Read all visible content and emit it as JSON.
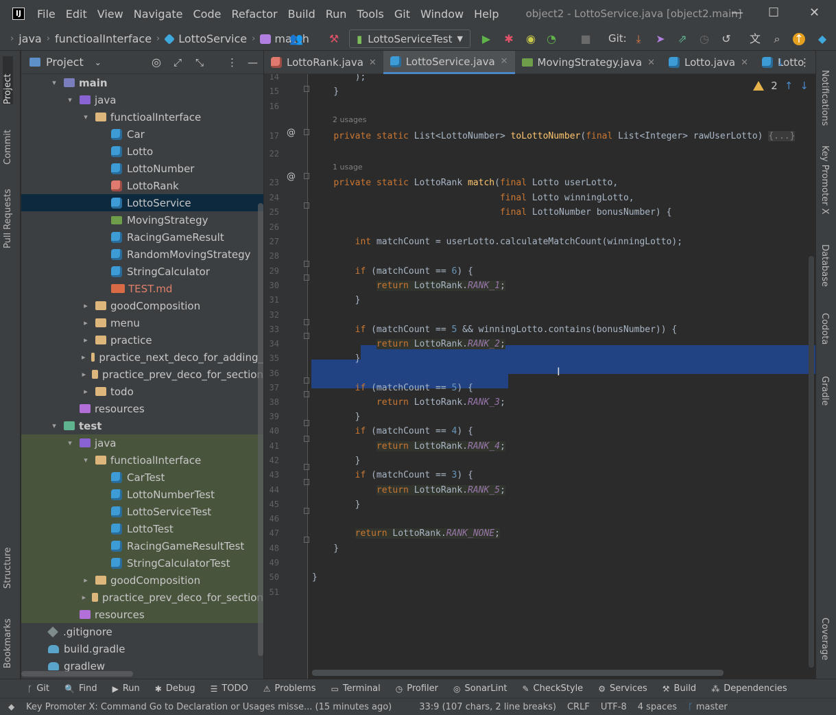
{
  "window": {
    "title": "object2 - LottoService.java [object2.main]",
    "menu": [
      "File",
      "Edit",
      "View",
      "Navigate",
      "Code",
      "Refactor",
      "Build",
      "Run",
      "Tools",
      "Git",
      "Window",
      "Help"
    ],
    "controls": [
      "—",
      "☐",
      "✕"
    ]
  },
  "navbar": {
    "breadcrumbs": [
      "java",
      "functioalInterface",
      "LottoService",
      "match"
    ],
    "run_config": "LottoServiceTest",
    "git_label": "Git:"
  },
  "left_stripe": {
    "tabs": [
      "Project",
      "Commit",
      "Pull Requests",
      "Structure",
      "Bookmarks"
    ]
  },
  "right_stripe": {
    "tabs": [
      "Notifications",
      "Key Promoter X",
      "Database",
      "Codota",
      "Gradle",
      "Coverage"
    ]
  },
  "project_panel": {
    "title": "Project",
    "tree": [
      {
        "label": "main",
        "kind": "folder-main",
        "arrow": "▾",
        "bold": true
      },
      {
        "label": "java",
        "kind": "folder-src",
        "arrow": "▾"
      },
      {
        "label": "functioalInterface",
        "kind": "folder",
        "arrow": "▾"
      },
      {
        "label": "Car",
        "kind": "class"
      },
      {
        "label": "Lotto",
        "kind": "class"
      },
      {
        "label": "LottoNumber",
        "kind": "class"
      },
      {
        "label": "LottoRank",
        "kind": "enum"
      },
      {
        "label": "LottoService",
        "kind": "class",
        "selected": true
      },
      {
        "label": "MovingStrategy",
        "kind": "iface"
      },
      {
        "label": "RacingGameResult",
        "kind": "class"
      },
      {
        "label": "RandomMovingStrategy",
        "kind": "class"
      },
      {
        "label": "StringCalculator",
        "kind": "class"
      },
      {
        "label": "TEST.md",
        "kind": "md",
        "color": "#e0806a"
      },
      {
        "label": "goodComposition",
        "kind": "folder",
        "arrow": "▸"
      },
      {
        "label": "menu",
        "kind": "folder",
        "arrow": "▸"
      },
      {
        "label": "practice",
        "kind": "folder",
        "arrow": "▸"
      },
      {
        "label": "practice_next_deco_for_adding_",
        "kind": "folder",
        "arrow": "▸"
      },
      {
        "label": "practice_prev_deco_for_section",
        "kind": "folder",
        "arrow": "▸"
      },
      {
        "label": "todo",
        "kind": "folder",
        "arrow": "▸"
      },
      {
        "label": "resources",
        "kind": "folder-res"
      },
      {
        "label": "test",
        "kind": "folder-test",
        "arrow": "▾",
        "bold": true
      },
      {
        "label": "java",
        "kind": "folder-src",
        "arrow": "▾",
        "test": true
      },
      {
        "label": "functioalInterface",
        "kind": "folder",
        "arrow": "▾",
        "test": true
      },
      {
        "label": "CarTest",
        "kind": "class",
        "test": true
      },
      {
        "label": "LottoNumberTest",
        "kind": "class",
        "test": true
      },
      {
        "label": "LottoServiceTest",
        "kind": "class",
        "test": true
      },
      {
        "label": "LottoTest",
        "kind": "class",
        "test": true
      },
      {
        "label": "RacingGameResultTest",
        "kind": "class",
        "test": true
      },
      {
        "label": "StringCalculatorTest",
        "kind": "class",
        "test": true
      },
      {
        "label": "goodComposition",
        "kind": "folder",
        "arrow": "▸",
        "test": true
      },
      {
        "label": "practice_prev_deco_for_section",
        "kind": "folder",
        "arrow": "▸",
        "test": true
      },
      {
        "label": "resources",
        "kind": "folder-res",
        "test": true
      },
      {
        "label": ".gitignore",
        "kind": "file"
      },
      {
        "label": "build.gradle",
        "kind": "gradle"
      },
      {
        "label": "gradlew",
        "kind": "gradle"
      }
    ]
  },
  "editor_tabs": [
    {
      "label": "LottoRank.java",
      "kind": "enum"
    },
    {
      "label": "LottoService.java",
      "kind": "class",
      "active": true
    },
    {
      "label": "MovingStrategy.java",
      "kind": "iface"
    },
    {
      "label": "Lotto.java",
      "kind": "class"
    },
    {
      "label": "Lotto",
      "kind": "class"
    }
  ],
  "inspection": {
    "warnings": "2"
  },
  "code_lines": [
    {
      "n": "14",
      "html": "        );"
    },
    {
      "n": "15",
      "html": "    }"
    },
    {
      "n": "16",
      "html": ""
    },
    {
      "hint": "2 usages"
    },
    {
      "n": "17",
      "html": "    <span class='kw'>private static</span> List&lt;LottoNumber&gt; <span class='fn'>toLottoNumber</span>(<span class='kw'>final</span> List&lt;Integer&gt; rawUserLotto) <span style='color:#808080;background:#3b3b3b'>{...}</span>"
    },
    {
      "n": "22",
      "html": ""
    },
    {
      "hint": "1 usage"
    },
    {
      "n": "23",
      "html": "    <span class='kw'>private static</span> LottoRank <span class='fn'>match</span>(<span class='kw'>final</span> Lotto userLotto,"
    },
    {
      "n": "24",
      "html": "                                   <span class='kw'>final</span> Lotto winningLotto,"
    },
    {
      "n": "25",
      "html": "                                   <span class='kw'>final</span> LottoNumber bonusNumber) {"
    },
    {
      "n": "26",
      "html": ""
    },
    {
      "n": "27",
      "html": "        <span class='kw'>int</span> matchCount = userLotto.calculateMatchCount(winningLotto);"
    },
    {
      "n": "28",
      "html": ""
    },
    {
      "n": "29",
      "html": "        <span class='kw'>if</span> (matchCount <span style='color:#a9b7c6'>==</span> <span class='num'>6</span>) {"
    },
    {
      "n": "30",
      "html": "            <span class='ret-hl'><span class='kw'>return</span> LottoRank.<span class='const'>RANK_1</span>;</span>"
    },
    {
      "n": "31",
      "html": "        }"
    },
    {
      "n": "32",
      "html": ""
    },
    {
      "n": "33",
      "html": "        <span class='kw'>if</span> (matchCount == <span class='num'>5</span> &amp;&amp; winningLotto.contains(bonusNumber)) {"
    },
    {
      "n": "34",
      "html": "            <span class='ret-hl'><span class='kw'>return</span> LottoRank.<span class='const'>RANK_2</span>;</span>"
    },
    {
      "n": "35",
      "html": "        }"
    },
    {
      "n": "36",
      "html": ""
    },
    {
      "n": "37",
      "html": "        <span class='kw'>if</span> (matchCount == <span class='num'>5</span>) {"
    },
    {
      "n": "38",
      "html": "            <span class='kw'>return</span> LottoRank.<span class='const'>RANK_3</span>;"
    },
    {
      "n": "39",
      "html": "        }"
    },
    {
      "n": "40",
      "html": "        <span class='kw'>if</span> (matchCount == <span class='num'>4</span>) {"
    },
    {
      "n": "41",
      "html": "            <span class='ret-hl'><span class='kw'>return</span> LottoRank.<span class='const'>RANK_4</span>;</span>"
    },
    {
      "n": "42",
      "html": "        }"
    },
    {
      "n": "43",
      "html": "        <span class='kw'>if</span> (matchCount == <span class='num'>3</span>) {"
    },
    {
      "n": "44",
      "html": "            <span class='ret-hl'><span class='kw'>return</span> LottoRank.<span class='const'>RANK_5</span>;</span>"
    },
    {
      "n": "45",
      "html": "        }"
    },
    {
      "n": "46",
      "html": ""
    },
    {
      "n": "47",
      "html": "        <span class='ret-hl'><span class='kw'>return</span> LottoRank.<span class='const'>RANK_NONE</span>;</span>"
    },
    {
      "n": "48",
      "html": "    }"
    },
    {
      "n": "49",
      "html": ""
    },
    {
      "n": "50",
      "html": "}"
    },
    {
      "n": "51",
      "html": ""
    }
  ],
  "bottom_tools": [
    {
      "label": "Git",
      "icon": "ᚴ"
    },
    {
      "label": "Find",
      "icon": "🔍"
    },
    {
      "label": "Run",
      "icon": "▶"
    },
    {
      "label": "Debug",
      "icon": "✱"
    },
    {
      "label": "TODO",
      "icon": "☰"
    },
    {
      "label": "Problems",
      "icon": "⚠"
    },
    {
      "label": "Terminal",
      "icon": "▭"
    },
    {
      "label": "Profiler",
      "icon": "◷"
    },
    {
      "label": "SonarLint",
      "icon": "◎"
    },
    {
      "label": "CheckStyle",
      "icon": "✎"
    },
    {
      "label": "Services",
      "icon": "⚙"
    },
    {
      "label": "Build",
      "icon": "⚒"
    },
    {
      "label": "Dependencies",
      "icon": "⁂"
    }
  ],
  "status": {
    "message": "Key Promoter X: Command Go to Declaration or Usages misse... (15 minutes ago)",
    "position": "33:9 (107 chars, 2 line breaks)",
    "line_sep": "CRLF",
    "encoding": "UTF-8",
    "indent": "4 spaces",
    "branch": "master"
  },
  "colors": {
    "accent": "#4a88c7",
    "selection": "#214283",
    "keyword": "#cc7832",
    "function": "#ffc66d",
    "number": "#6897bb",
    "constant": "#9876aa"
  }
}
